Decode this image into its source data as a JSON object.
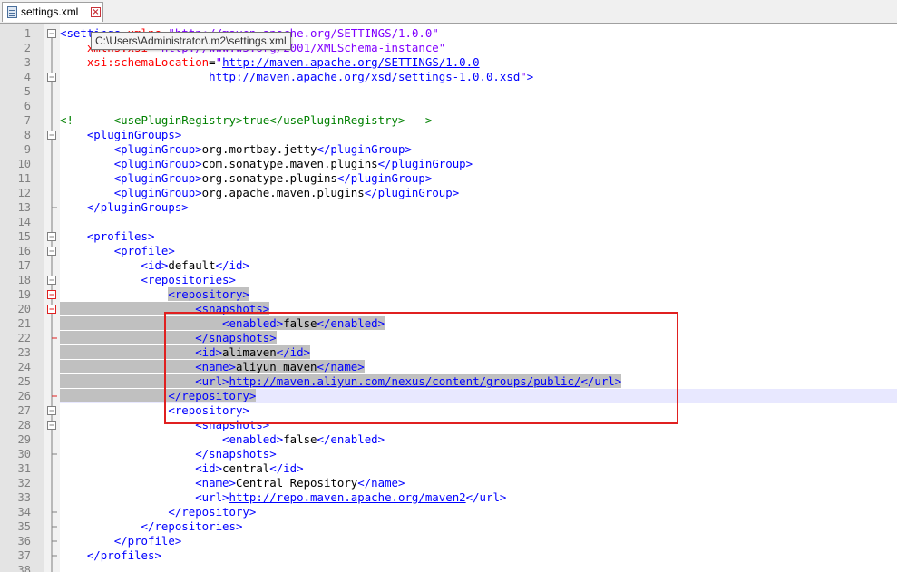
{
  "tab": {
    "title": "settings.xml"
  },
  "tooltip": {
    "text": "C:\\Users\\Administrator\\.m2\\settings.xml"
  },
  "colors": {
    "selection": "#c0c0c0",
    "current_line": "#e8e8ff",
    "annotation_box": "#e02020"
  },
  "lines": [
    {
      "n": "1",
      "tokens": [
        [
          "tag",
          "<settings "
        ],
        [
          "attr",
          "xmlns"
        ],
        [
          "",
          "="
        ],
        [
          "val",
          "\"http://maven.apache.org/SETTINGS/1.0.0\""
        ]
      ]
    },
    {
      "n": "2",
      "tokens": [
        [
          "",
          "    "
        ],
        [
          "attr",
          "xmlns:xsi"
        ],
        [
          "",
          "="
        ],
        [
          "val",
          "\"http://www.w3.org/2001/XMLSchema-instance\""
        ]
      ]
    },
    {
      "n": "3",
      "tokens": [
        [
          "",
          "    "
        ],
        [
          "attr",
          "xsi:schemaLocation"
        ],
        [
          "",
          "="
        ],
        [
          "val",
          "\""
        ],
        [
          "link",
          "http://maven.apache.org/SETTINGS/1.0.0"
        ]
      ]
    },
    {
      "n": "4",
      "tokens": [
        [
          "",
          "                      "
        ],
        [
          "link",
          "http://maven.apache.org/xsd/settings-1.0.0.xsd"
        ],
        [
          "val",
          "\""
        ],
        [
          "tag",
          ">"
        ]
      ]
    },
    {
      "n": "5",
      "tokens": []
    },
    {
      "n": "6",
      "tokens": []
    },
    {
      "n": "7",
      "tokens": [
        [
          "comment",
          "<!--    <usePluginRegistry>true</usePluginRegistry> -->"
        ]
      ]
    },
    {
      "n": "8",
      "tokens": [
        [
          "",
          "    "
        ],
        [
          "tag",
          "<pluginGroups>"
        ]
      ]
    },
    {
      "n": "9",
      "tokens": [
        [
          "",
          "        "
        ],
        [
          "tag",
          "<pluginGroup>"
        ],
        [
          "",
          "org.mortbay.jetty"
        ],
        [
          "tag",
          "</pluginGroup>"
        ]
      ]
    },
    {
      "n": "10",
      "tokens": [
        [
          "",
          "        "
        ],
        [
          "tag",
          "<pluginGroup>"
        ],
        [
          "",
          "com.sonatype.maven.plugins"
        ],
        [
          "tag",
          "</pluginGroup>"
        ]
      ]
    },
    {
      "n": "11",
      "tokens": [
        [
          "",
          "        "
        ],
        [
          "tag",
          "<pluginGroup>"
        ],
        [
          "",
          "org.sonatype.plugins"
        ],
        [
          "tag",
          "</pluginGroup>"
        ]
      ]
    },
    {
      "n": "12",
      "tokens": [
        [
          "",
          "        "
        ],
        [
          "tag",
          "<pluginGroup>"
        ],
        [
          "",
          "org.apache.maven.plugins"
        ],
        [
          "tag",
          "</pluginGroup>"
        ]
      ]
    },
    {
      "n": "13",
      "tokens": [
        [
          "",
          "    "
        ],
        [
          "tag",
          "</pluginGroups>"
        ]
      ]
    },
    {
      "n": "14",
      "tokens": []
    },
    {
      "n": "15",
      "tokens": [
        [
          "",
          "    "
        ],
        [
          "tag",
          "<profiles>"
        ]
      ]
    },
    {
      "n": "16",
      "tokens": [
        [
          "",
          "        "
        ],
        [
          "tag",
          "<profile>"
        ]
      ]
    },
    {
      "n": "17",
      "tokens": [
        [
          "",
          "            "
        ],
        [
          "tag",
          "<id>"
        ],
        [
          "",
          "default"
        ],
        [
          "tag",
          "</id>"
        ]
      ]
    },
    {
      "n": "18",
      "tokens": [
        [
          "",
          "            "
        ],
        [
          "tag",
          "<repositories>"
        ]
      ]
    },
    {
      "n": "19",
      "tokens": [
        [
          "",
          "                "
        ],
        [
          "tag",
          "<repository>"
        ]
      ]
    },
    {
      "n": "20",
      "tokens": [
        [
          "",
          "                    "
        ],
        [
          "tag",
          "<snapshots>"
        ]
      ]
    },
    {
      "n": "21",
      "tokens": [
        [
          "",
          "                        "
        ],
        [
          "tag",
          "<enabled>"
        ],
        [
          "",
          "false"
        ],
        [
          "tag",
          "</enabled>"
        ]
      ]
    },
    {
      "n": "22",
      "tokens": [
        [
          "",
          "                    "
        ],
        [
          "tag",
          "</snapshots>"
        ]
      ]
    },
    {
      "n": "23",
      "tokens": [
        [
          "",
          "                    "
        ],
        [
          "tag",
          "<id>"
        ],
        [
          "",
          "alimaven"
        ],
        [
          "tag",
          "</id>"
        ]
      ]
    },
    {
      "n": "24",
      "tokens": [
        [
          "",
          "                    "
        ],
        [
          "tag",
          "<name>"
        ],
        [
          "",
          "aliyun maven"
        ],
        [
          "tag",
          "</name>"
        ]
      ]
    },
    {
      "n": "25",
      "tokens": [
        [
          "",
          "                    "
        ],
        [
          "tag",
          "<url>"
        ],
        [
          "link",
          "http://maven.aliyun.com/nexus/content/groups/public/"
        ],
        [
          "tag",
          "</url>"
        ]
      ]
    },
    {
      "n": "26",
      "tokens": [
        [
          "",
          "                "
        ],
        [
          "tag",
          "</repository>"
        ]
      ]
    },
    {
      "n": "27",
      "tokens": [
        [
          "",
          "                "
        ],
        [
          "tag",
          "<repository>"
        ]
      ]
    },
    {
      "n": "28",
      "tokens": [
        [
          "",
          "                    "
        ],
        [
          "tag",
          "<snapshots>"
        ]
      ]
    },
    {
      "n": "29",
      "tokens": [
        [
          "",
          "                        "
        ],
        [
          "tag",
          "<enabled>"
        ],
        [
          "",
          "false"
        ],
        [
          "tag",
          "</enabled>"
        ]
      ]
    },
    {
      "n": "30",
      "tokens": [
        [
          "",
          "                    "
        ],
        [
          "tag",
          "</snapshots>"
        ]
      ]
    },
    {
      "n": "31",
      "tokens": [
        [
          "",
          "                    "
        ],
        [
          "tag",
          "<id>"
        ],
        [
          "",
          "central"
        ],
        [
          "tag",
          "</id>"
        ]
      ]
    },
    {
      "n": "32",
      "tokens": [
        [
          "",
          "                    "
        ],
        [
          "tag",
          "<name>"
        ],
        [
          "",
          "Central Repository"
        ],
        [
          "tag",
          "</name>"
        ]
      ]
    },
    {
      "n": "33",
      "tokens": [
        [
          "",
          "                    "
        ],
        [
          "tag",
          "<url>"
        ],
        [
          "link",
          "http://repo.maven.apache.org/maven2"
        ],
        [
          "tag",
          "</url>"
        ]
      ]
    },
    {
      "n": "34",
      "tokens": [
        [
          "",
          "                "
        ],
        [
          "tag",
          "</repository>"
        ]
      ]
    },
    {
      "n": "35",
      "tokens": [
        [
          "",
          "            "
        ],
        [
          "tag",
          "</repositories>"
        ]
      ]
    },
    {
      "n": "36",
      "tokens": [
        [
          "",
          "        "
        ],
        [
          "tag",
          "</profile>"
        ]
      ]
    },
    {
      "n": "37",
      "tokens": [
        [
          "",
          "    "
        ],
        [
          "tag",
          "</profiles>"
        ]
      ]
    },
    {
      "n": "38",
      "tokens": []
    }
  ],
  "selected_lines": [
    "19",
    "20",
    "21",
    "22",
    "23",
    "24",
    "25",
    "26"
  ],
  "current_line": "26",
  "fold_markers": [
    {
      "line": "1",
      "kind": "open"
    },
    {
      "line": "4",
      "kind": "box"
    },
    {
      "line": "8",
      "kind": "box"
    },
    {
      "line": "13",
      "kind": "end"
    },
    {
      "line": "15",
      "kind": "box"
    },
    {
      "line": "16",
      "kind": "box"
    },
    {
      "line": "18",
      "kind": "box"
    },
    {
      "line": "19",
      "kind": "box-red"
    },
    {
      "line": "20",
      "kind": "box-red"
    },
    {
      "line": "22",
      "kind": "end-red"
    },
    {
      "line": "26",
      "kind": "end-red"
    },
    {
      "line": "27",
      "kind": "box"
    },
    {
      "line": "28",
      "kind": "box"
    },
    {
      "line": "30",
      "kind": "end"
    },
    {
      "line": "34",
      "kind": "end"
    },
    {
      "line": "35",
      "kind": "end"
    },
    {
      "line": "36",
      "kind": "end"
    },
    {
      "line": "37",
      "kind": "end"
    }
  ]
}
